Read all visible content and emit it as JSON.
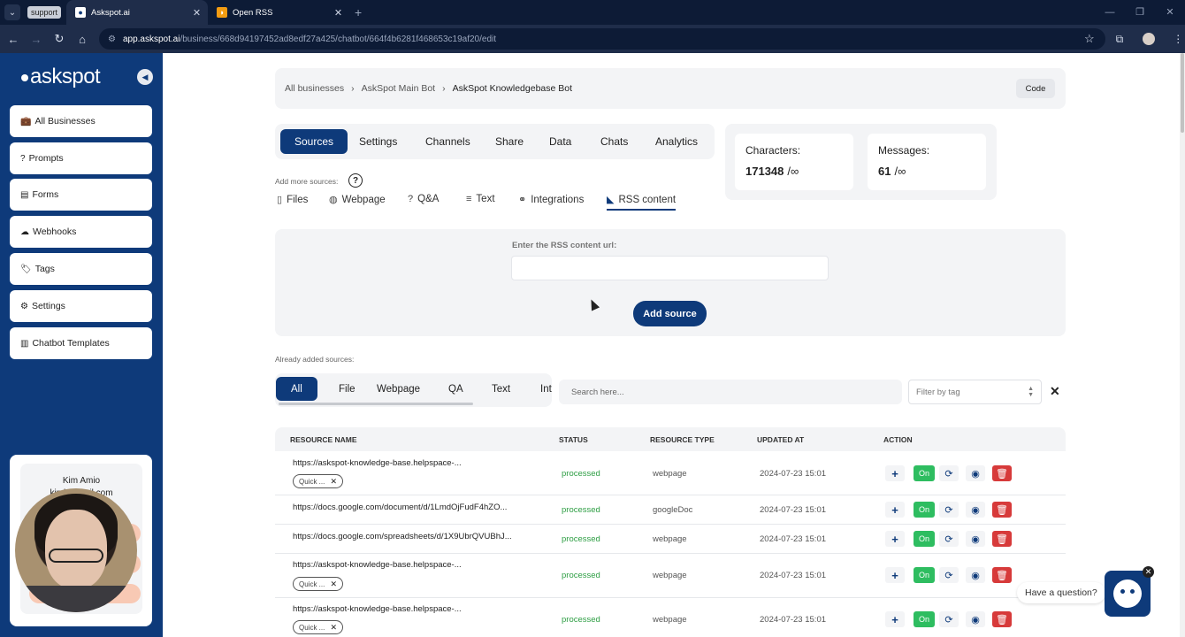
{
  "browser": {
    "support_badge": "support",
    "tabs": [
      {
        "title": "Askspot.ai"
      },
      {
        "title": "Open RSS"
      }
    ],
    "url_host": "app.askspot.ai",
    "url_path": "/business/668d94197452ad8edf27a425/chatbot/664f4b6281f468653c19af20/edit"
  },
  "sidebar": {
    "logo": "askspot",
    "items": [
      {
        "label": "All Businesses",
        "icon": "briefcase-icon"
      },
      {
        "label": "Prompts",
        "icon": "question-icon"
      },
      {
        "label": "Forms",
        "icon": "form-icon"
      },
      {
        "label": "Webhooks",
        "icon": "webhook-icon"
      },
      {
        "label": "Tags",
        "icon": "tags-icon"
      },
      {
        "label": "Settings",
        "icon": "gear-icon"
      },
      {
        "label": "Chatbot Templates",
        "icon": "template-icon"
      }
    ],
    "user": {
      "name": "Kim Amio",
      "email": "kimb…mail.com"
    }
  },
  "breadcrumb": {
    "items": [
      "All businesses",
      "AskSpot Main Bot",
      "AskSpot Knowledgebase Bot"
    ],
    "code_label": "Code"
  },
  "main_tabs": [
    "Sources",
    "Settings",
    "Channels",
    "Share",
    "Data",
    "Chats",
    "Analytics"
  ],
  "stats": {
    "characters_label": "Characters:",
    "characters_value": "171348",
    "messages_label": "Messages:",
    "messages_value": "61",
    "limit": "/∞"
  },
  "sources": {
    "add_more_label": "Add more sources:",
    "tabs": [
      "Files",
      "Webpage",
      "Q&A",
      "Text",
      "Integrations",
      "RSS content"
    ],
    "active_tab": "RSS content"
  },
  "rss": {
    "label": "Enter the RSS content url:",
    "input_value": "",
    "add_button": "Add source"
  },
  "added": {
    "label": "Already added sources:",
    "filters": [
      "All",
      "File",
      "Webpage",
      "QA",
      "Text",
      "Int"
    ],
    "search_placeholder": "Search here...",
    "tag_placeholder": "Filter by tag"
  },
  "table": {
    "headers": [
      "RESOURCE NAME",
      "STATUS",
      "RESOURCE TYPE",
      "UPDATED AT",
      "ACTION"
    ],
    "on_label": "On",
    "rows": [
      {
        "name": "https://askspot-knowledge-base.helpspace-...",
        "tag": "Quick ...",
        "status": "processed",
        "type": "webpage",
        "updated": "2024-07-23 15:01"
      },
      {
        "name": "https://docs.google.com/document/d/1LmdOjFudF4hZO...",
        "tag": "",
        "status": "processed",
        "type": "googleDoc",
        "updated": "2024-07-23 15:01"
      },
      {
        "name": "https://docs.google.com/spreadsheets/d/1X9UbrQVUBhJ...",
        "tag": "",
        "status": "processed",
        "type": "webpage",
        "updated": "2024-07-23 15:01"
      },
      {
        "name": "https://askspot-knowledge-base.helpspace-...",
        "tag": "Quick ...",
        "status": "processed",
        "type": "webpage",
        "updated": "2024-07-23 15:01"
      },
      {
        "name": "https://askspot-knowledge-base.helpspace-...",
        "tag": "Quick ...",
        "status": "processed",
        "type": "webpage",
        "updated": "2024-07-23 15:01"
      }
    ]
  },
  "chat_widget": {
    "prompt": "Have a question?"
  }
}
